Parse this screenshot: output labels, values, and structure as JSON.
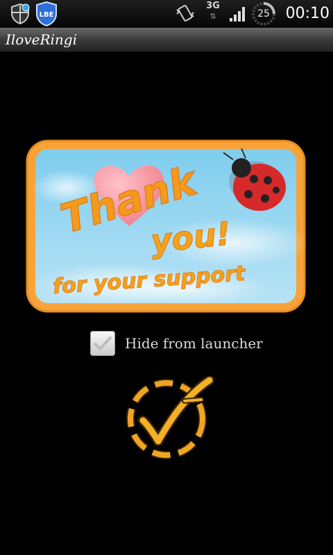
{
  "status_bar": {
    "network_type": "3G",
    "battery_level": "25",
    "clock": "00:10",
    "notification_icons": [
      "shield-icon",
      "lbe-icon"
    ],
    "lbe_text": "LBE",
    "icons": [
      "vibrate-icon",
      "signal-icon",
      "battery-icon"
    ]
  },
  "app": {
    "title": "IloveRingi"
  },
  "card": {
    "line1": "Thank",
    "line2": "you!",
    "line3": "for your support",
    "colors": {
      "frame": "#f7a33a",
      "sky": "#8fd3ee",
      "lettering": "#f59a1c",
      "heart": "#f08a95",
      "ladybug": "#d62a2a"
    }
  },
  "options": {
    "hide_from_launcher": {
      "label": "Hide from launcher",
      "checked": true
    }
  },
  "confirm": {
    "icon": "checkmark-circle-icon",
    "color": "#f0a522"
  }
}
